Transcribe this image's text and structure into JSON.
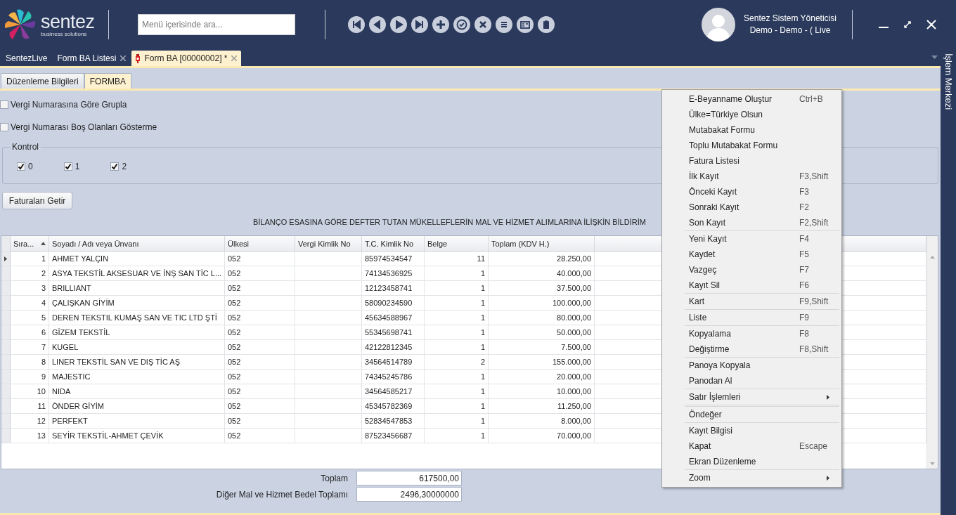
{
  "header": {
    "logo": {
      "name": "sentez",
      "tagline": "business solutions"
    },
    "search": {
      "placeholder": "Menü içerisinde ara..."
    },
    "user": {
      "name": "Sentez Sistem Yöneticisi",
      "context": "Demo - Demo - ( Live"
    }
  },
  "tabs": [
    {
      "label": "SentezLive",
      "closable": false,
      "selected": false
    },
    {
      "label": "Form BA Listesi",
      "closable": true,
      "selected": false
    },
    {
      "label": "Form BA [00000002]  *",
      "closable": true,
      "selected": true
    }
  ],
  "side_panel": {
    "title": "İşlem Merkezi"
  },
  "subtabs": [
    {
      "label": "Düzenleme Bilgileri",
      "selected": false
    },
    {
      "label": "FORMBA",
      "selected": true
    }
  ],
  "options": [
    {
      "label": "Vergi Numarasına Göre Grupla",
      "checked": false
    },
    {
      "label": "Vergi Numarası Boş Olanları Gösterme",
      "checked": false
    }
  ],
  "kontrol": {
    "title": "Kontrol",
    "items": [
      {
        "label": "0",
        "checked": true
      },
      {
        "label": "1",
        "checked": true
      },
      {
        "label": "2",
        "checked": true
      }
    ]
  },
  "fetch_button": "Faturaları Getir",
  "report_title": "BİLANÇO ESASINA GÖRE DEFTER TUTAN MÜKELLEFLERİN MAL VE HİZMET ALIMLARINA İLİŞKİN BİLDİRİM",
  "table": {
    "columns": [
      {
        "label": "Sıra...",
        "sorted": true
      },
      {
        "label": "Soyadı / Adı veya Ünvanı"
      },
      {
        "label": "Ülkesi"
      },
      {
        "label": "Vergi Kimlik No"
      },
      {
        "label": "T.C. Kimlik No"
      },
      {
        "label": "Belge"
      },
      {
        "label": "Toplam (KDV H.)"
      }
    ],
    "rows": [
      {
        "current": true,
        "cells": [
          "1",
          "AHMET YALÇIN",
          "052",
          "",
          "85974534547",
          "11",
          "28.250,00"
        ]
      },
      {
        "current": false,
        "cells": [
          "2",
          "ASYA TEKSTİL AKSESUAR VE İNŞ SAN TİC L...",
          "052",
          "",
          "74134536925",
          "1",
          "40.000,00"
        ]
      },
      {
        "current": false,
        "cells": [
          "3",
          "BRILLIANT",
          "052",
          "",
          "12123458741",
          "1",
          "37.500,00"
        ]
      },
      {
        "current": false,
        "cells": [
          "4",
          "ÇALIŞKAN GİYİM",
          "052",
          "",
          "58090234590",
          "1",
          "100.000,00"
        ]
      },
      {
        "current": false,
        "cells": [
          "5",
          "DEREN TEKSTIL KUMAŞ SAN VE TIC LTD ŞTİ",
          "052",
          "",
          "45634588967",
          "1",
          "80.000,00"
        ]
      },
      {
        "current": false,
        "cells": [
          "6",
          "GİZEM TEKSTİL",
          "052",
          "",
          "55345698741",
          "1",
          "50.000,00"
        ]
      },
      {
        "current": false,
        "cells": [
          "7",
          "KUGEL",
          "052",
          "",
          "42122812345",
          "1",
          "7.500,00"
        ]
      },
      {
        "current": false,
        "cells": [
          "8",
          "LINER TEKSTİL SAN VE DIŞ TİC AŞ",
          "052",
          "",
          "34564514789",
          "2",
          "155.000,00"
        ]
      },
      {
        "current": false,
        "cells": [
          "9",
          "MAJESTIC",
          "052",
          "",
          "74345245786",
          "1",
          "20.000,00"
        ]
      },
      {
        "current": false,
        "cells": [
          "10",
          "NIDA",
          "052",
          "",
          "34564585217",
          "1",
          "10.000,00"
        ]
      },
      {
        "current": false,
        "cells": [
          "11",
          "ÖNDER GİYİM",
          "052",
          "",
          "45345782369",
          "1",
          "11.250,00"
        ]
      },
      {
        "current": false,
        "cells": [
          "12",
          "PERFEKT",
          "052",
          "",
          "52834547853",
          "1",
          "8.000,00"
        ]
      },
      {
        "current": false,
        "cells": [
          "13",
          "SEYİR TEKSTİL-AHMET ÇEVİK",
          "052",
          "",
          "87523456687",
          "1",
          "70.000,00"
        ]
      }
    ]
  },
  "totals": [
    {
      "label": "Toplam",
      "value": "617500,00"
    },
    {
      "label": "Diğer Mal ve Hizmet Bedel Toplamı",
      "value": "2496,30000000"
    }
  ],
  "context_menu": {
    "groups": [
      [
        {
          "label": "E-Beyanname Oluştur",
          "shortcut": "Ctrl+B",
          "submenu": false
        },
        {
          "label": "Ülke=Türkiye Olsun",
          "submenu": false
        },
        {
          "label": "Mutabakat Formu",
          "submenu": false
        },
        {
          "label": "Toplu Mutabakat Formu",
          "submenu": false
        },
        {
          "label": "Fatura Listesi",
          "submenu": false
        },
        {
          "label": "İlk Kayıt",
          "shortcut": "F3,Shift",
          "submenu": false
        },
        {
          "label": "Önceki Kayıt",
          "shortcut": "F3",
          "submenu": false
        },
        {
          "label": "Sonraki Kayıt",
          "shortcut": "F2",
          "submenu": false
        },
        {
          "label": "Son Kayıt",
          "shortcut": "F2,Shift",
          "submenu": false
        }
      ],
      [
        {
          "label": "Yeni Kayıt",
          "shortcut": "F4",
          "submenu": false
        },
        {
          "label": "Kaydet",
          "shortcut": "F5",
          "submenu": false
        },
        {
          "label": "Vazgeç",
          "shortcut": "F7",
          "submenu": false
        },
        {
          "label": "Kayıt Sil",
          "shortcut": "F6",
          "submenu": false
        }
      ],
      [
        {
          "label": "Kart",
          "shortcut": "F9,Shift",
          "submenu": false
        }
      ],
      [
        {
          "label": "Liste",
          "shortcut": "F9",
          "submenu": false
        }
      ],
      [
        {
          "label": "Kopyalama",
          "shortcut": "F8",
          "submenu": false
        },
        {
          "label": "Değiştirme",
          "shortcut": "F8,Shift",
          "submenu": false
        }
      ],
      [
        {
          "label": "Panoya Kopyala",
          "submenu": false
        },
        {
          "label": "Panodan Al",
          "submenu": false
        }
      ],
      [
        {
          "label": "Satır İşlemleri",
          "submenu": true
        }
      ],
      [
        {
          "label": "Öndeğer",
          "submenu": false
        }
      ],
      [
        {
          "label": "Kayıt Bilgisi",
          "submenu": false
        },
        {
          "label": "Kapat",
          "shortcut": "Escape",
          "submenu": false
        },
        {
          "label": "Ekran Düzenleme",
          "submenu": false
        }
      ],
      [
        {
          "label": "Zoom",
          "submenu": true
        }
      ]
    ]
  }
}
